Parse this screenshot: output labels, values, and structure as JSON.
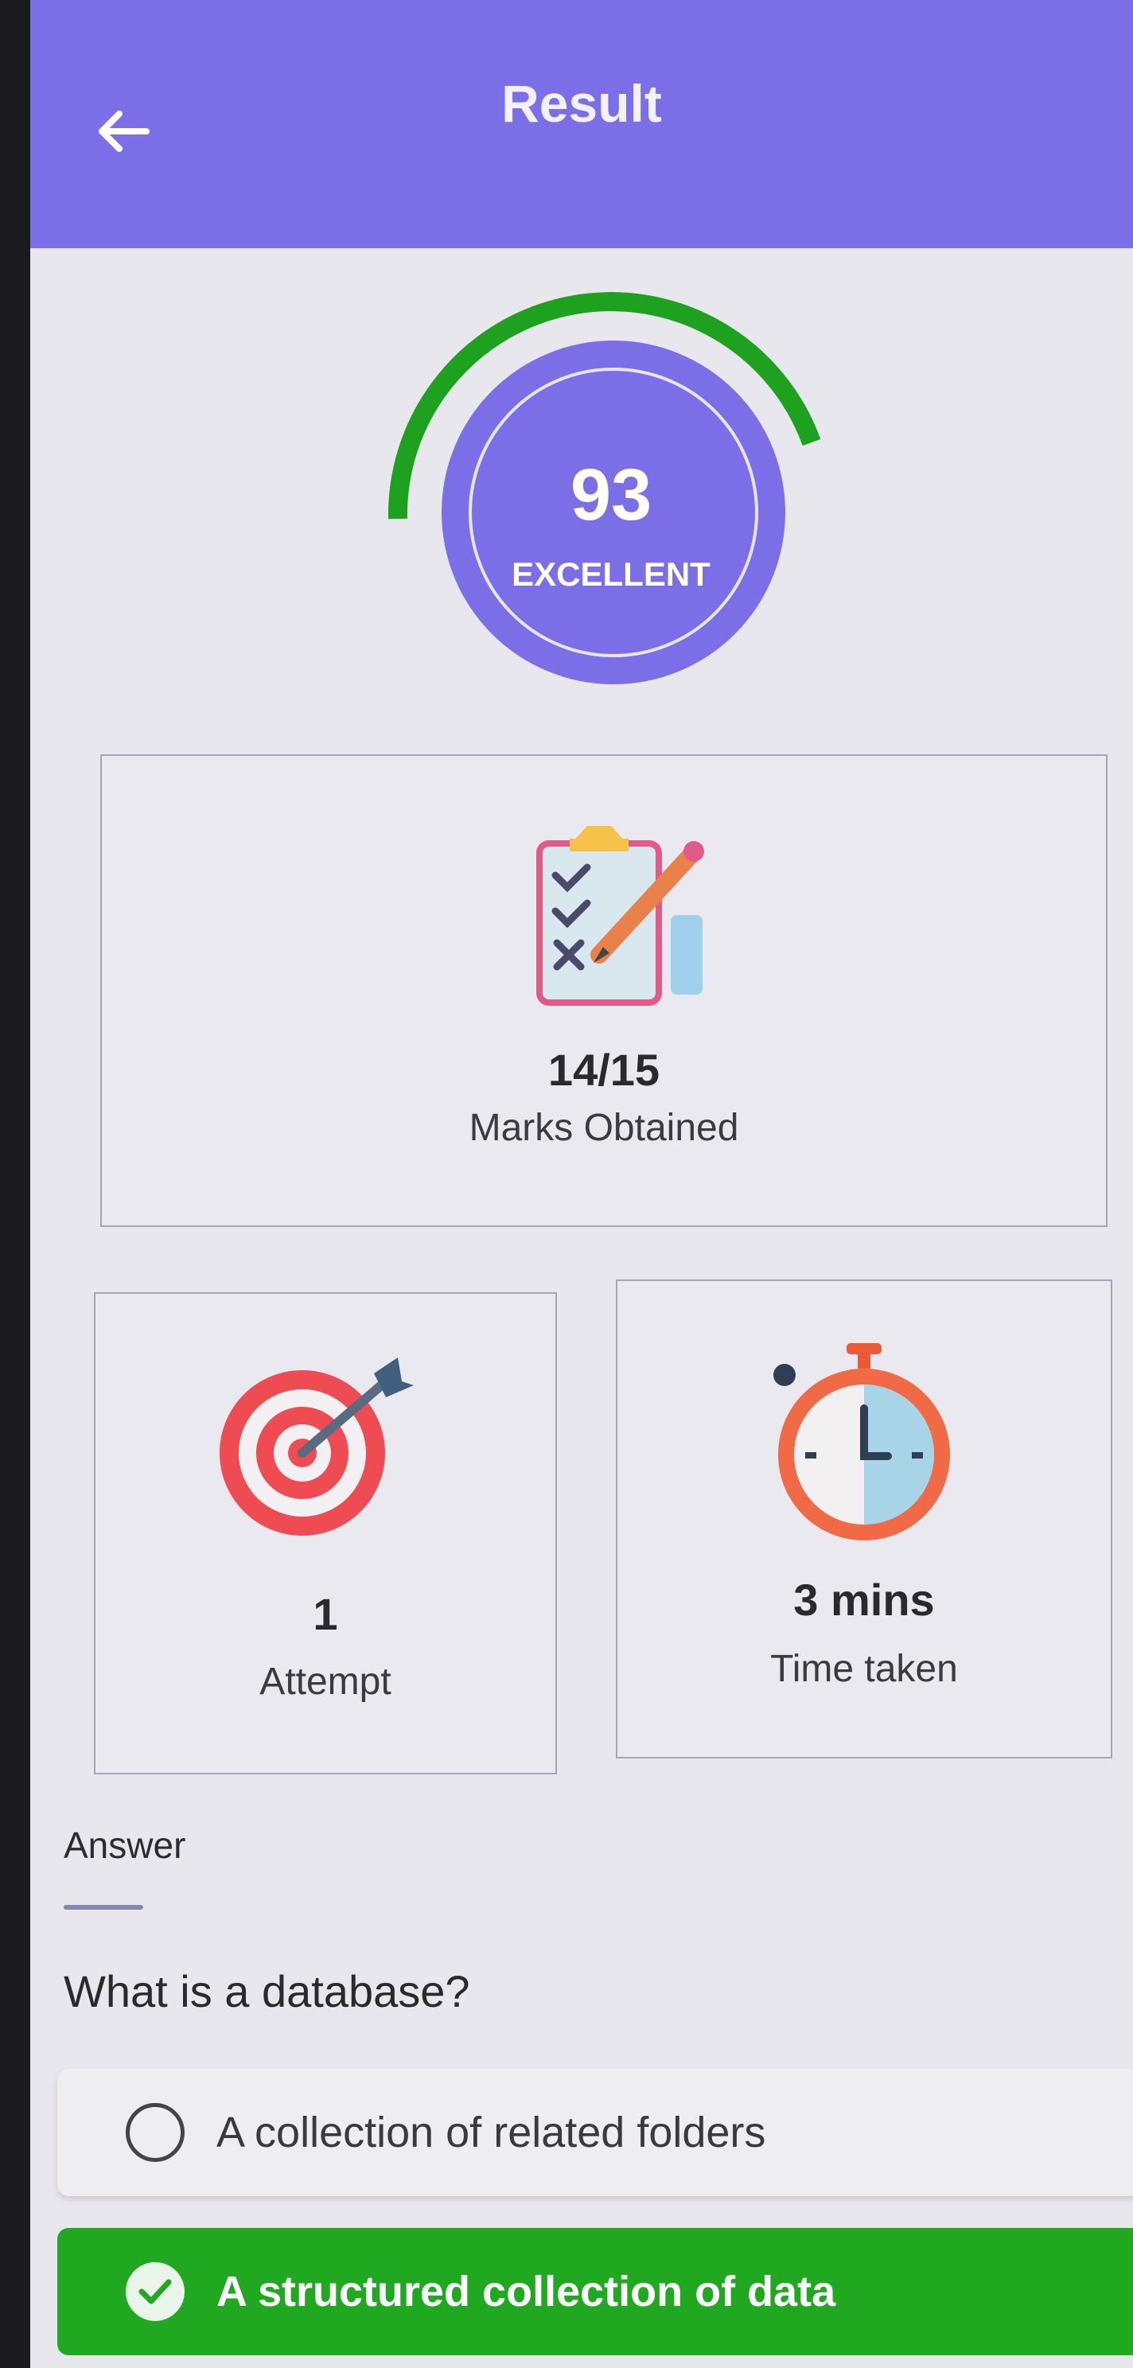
{
  "appbar": {
    "title": "Result",
    "back_icon": "arrow-left-icon"
  },
  "score": {
    "value": "93",
    "grade": "EXCELLENT",
    "progress": 0.93,
    "colors": {
      "arc": "#1ea11e",
      "circle": "#7b6ee6"
    }
  },
  "marks": {
    "icon": "clipboard-checklist-icon",
    "value": "14/15",
    "label": "Marks Obtained"
  },
  "attempt": {
    "icon": "target-dart-icon",
    "value": "1",
    "label": "Attempt"
  },
  "time": {
    "icon": "stopwatch-icon",
    "value": "3 mins",
    "label": "Time taken"
  },
  "answer": {
    "section_title": "Answer",
    "question": "What is a database?",
    "options": [
      {
        "text": "A collection of related folders",
        "selected": false
      },
      {
        "text": "A structured collection of data",
        "selected": true
      }
    ],
    "colors": {
      "correct": "#1fa820"
    }
  }
}
